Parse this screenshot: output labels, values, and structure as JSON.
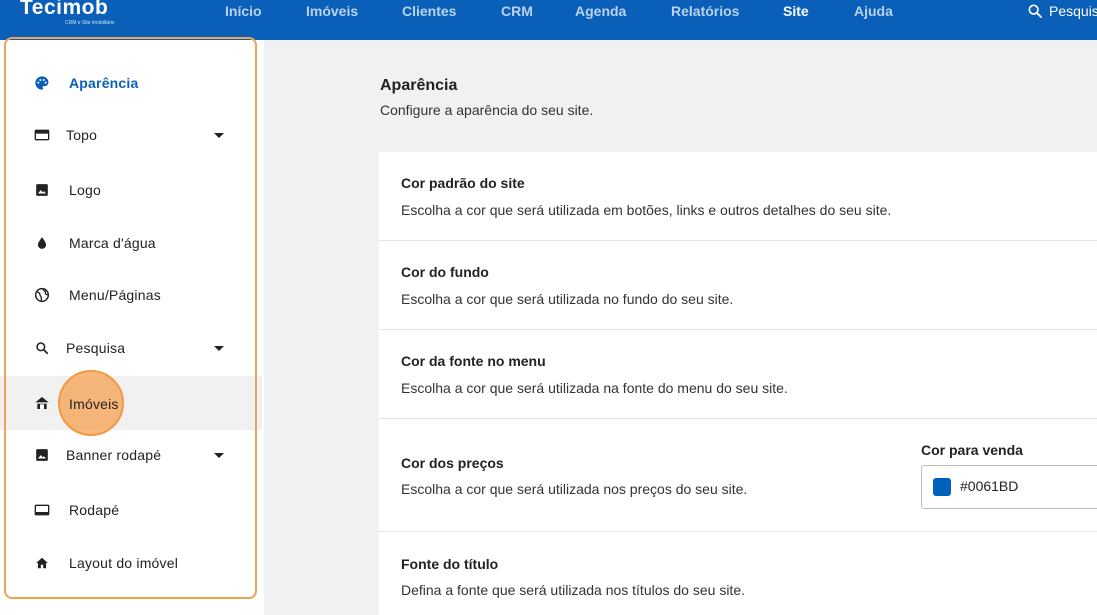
{
  "header": {
    "logo": "Tecimob",
    "logo_tagline": "CRM e Site imobiliário",
    "nav": [
      "Início",
      "Imóveis",
      "Clientes",
      "CRM",
      "Agenda",
      "Relatórios",
      "Site",
      "Ajuda"
    ],
    "active_nav": "Site",
    "search_label": "Pesquisar",
    "brand_color": "#0a5fb8"
  },
  "sidebar": {
    "items": [
      {
        "label": "Aparência",
        "icon": "palette-icon",
        "active": true
      },
      {
        "label": "Topo",
        "icon": "header-icon",
        "expandable": true
      },
      {
        "label": "Logo",
        "icon": "image-icon"
      },
      {
        "label": "Marca d'água",
        "icon": "water-drop-icon"
      },
      {
        "label": "Menu/Páginas",
        "icon": "globe-icon"
      },
      {
        "label": "Pesquisa",
        "icon": "search-icon",
        "expandable": true
      },
      {
        "label": "Imóveis",
        "icon": "house-icon",
        "hovered": true
      },
      {
        "label": "Banner rodapé",
        "icon": "image-icon",
        "expandable": true
      },
      {
        "label": "Rodapé",
        "icon": "footer-icon"
      },
      {
        "label": "Layout do imóvel",
        "icon": "home-icon"
      }
    ]
  },
  "main": {
    "title": "Aparência",
    "subtitle": "Configure a aparência do seu site.",
    "sections": [
      {
        "title": "Cor padrão do site",
        "description": "Escolha a cor que será utilizada em botões, links e outros detalhes do seu site."
      },
      {
        "title": "Cor do fundo",
        "description": "Escolha a cor que será utilizada no fundo do seu site."
      },
      {
        "title": "Cor da fonte no menu",
        "description": "Escolha a cor que será utilizada na fonte do menu do seu site."
      },
      {
        "title": "Cor dos preços",
        "description": "Escolha a cor que será utilizada nos preços do seu site."
      },
      {
        "title": "Fonte do título",
        "description": "Defina a fonte que será utilizada nos títulos do seu site."
      }
    ],
    "price_color": {
      "label": "Cor para venda",
      "value": "#0061BD",
      "swatch": "#0061BD"
    }
  }
}
